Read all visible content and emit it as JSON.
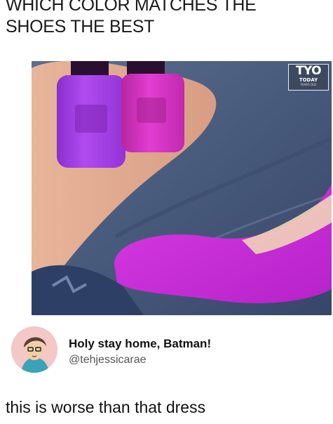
{
  "post": {
    "title_line1": "WHICH COLOR MATCHES THE",
    "title_line2": "SHOES THE BEST"
  },
  "watermark": {
    "logo": "TYO",
    "sub": "TODAY",
    "tiny": "YEARS OLD"
  },
  "colors": {
    "polish_left": "#a63be6",
    "polish_right": "#d531c8",
    "shoe": "#cc2fd9",
    "denim": "#4a5d80"
  },
  "tweet": {
    "display_name": "Holy stay home, Batman!",
    "handle": "@tehjessicarae",
    "text": "this is worse than that dress"
  }
}
